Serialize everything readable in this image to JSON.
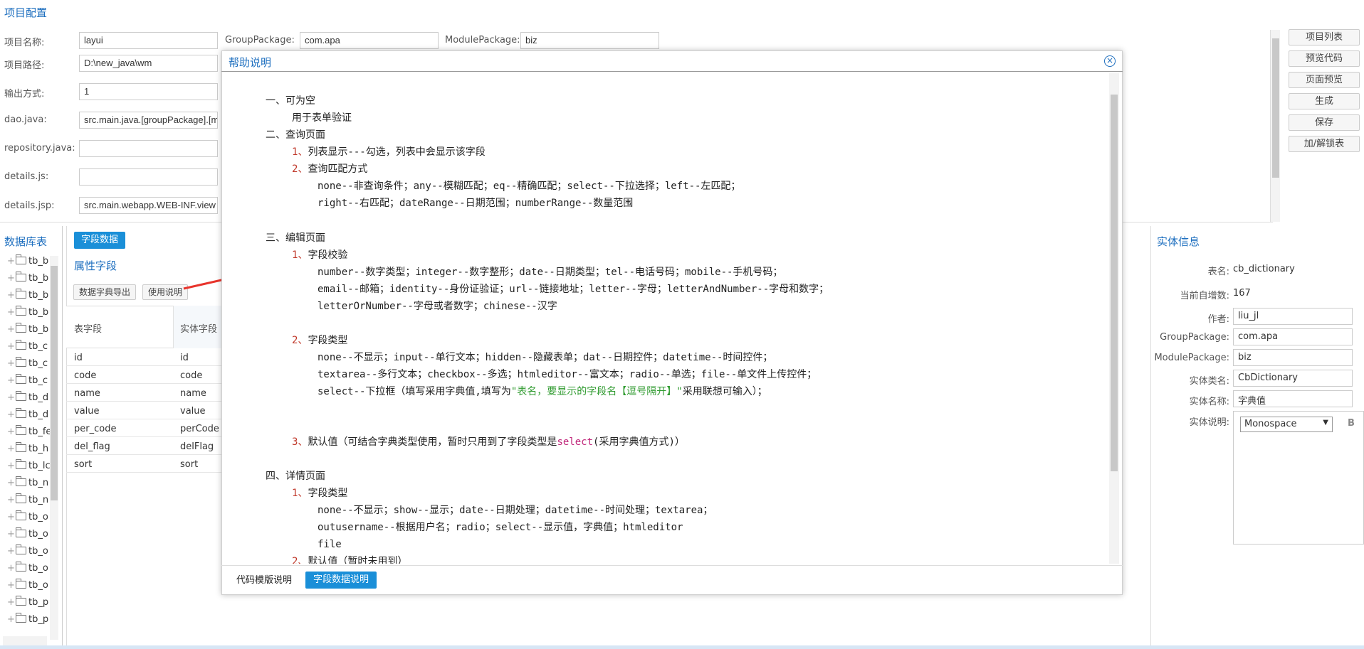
{
  "top": {
    "title": "项目配置",
    "fields": {
      "project_name": {
        "label": "项目名称:",
        "value": "layui"
      },
      "group_package": {
        "label": "GroupPackage:",
        "value": "com.apa"
      },
      "module_package": {
        "label": "ModulePackage:",
        "value": "biz"
      },
      "project_path": {
        "label": "项目路径:",
        "value": "D:\\new_java\\wm"
      },
      "output_mode": {
        "label": "输出方式:",
        "value": "1"
      },
      "dao_java": {
        "label": "dao.java:",
        "value": "src.main.java.[groupPackage].[m"
      },
      "repository_java": {
        "label": "repository.java:",
        "value": ""
      },
      "details_js": {
        "label": "details.js:",
        "value": ""
      },
      "details_jsp": {
        "label": "details.jsp:",
        "value": "src.main.webapp.WEB-INF.view"
      }
    },
    "buttons": [
      "项目列表",
      "预览代码",
      "页面预览",
      "生成",
      "保存",
      "加/解锁表"
    ]
  },
  "left": {
    "title": "数据库表",
    "items": [
      "tb_b",
      "tb_b",
      "tb_b",
      "tb_b",
      "tb_b",
      "tb_c",
      "tb_c",
      "tb_c",
      "tb_d",
      "tb_d",
      "tb_fe",
      "tb_h",
      "tb_lc",
      "tb_n",
      "tb_n",
      "tb_o",
      "tb_o",
      "tb_o",
      "tb_o",
      "tb_o",
      "tb_p",
      "tb_p"
    ]
  },
  "mid": {
    "tab": "字段数据",
    "attr_title": "属性字段",
    "export_btn": "数据字典导出",
    "help_btn": "使用说明",
    "col_table": "表字段",
    "col_entity": "实体字段",
    "rows": [
      [
        "id",
        "id"
      ],
      [
        "code",
        "code"
      ],
      [
        "name",
        "name"
      ],
      [
        "value",
        "value"
      ],
      [
        "per_code",
        "perCode"
      ],
      [
        "del_flag",
        "delFlag"
      ],
      [
        "sort",
        "sort"
      ]
    ]
  },
  "right": {
    "title": "实体信息",
    "table_name": {
      "label": "表名:",
      "value": "cb_dictionary"
    },
    "auto_inc": {
      "label": "当前自增数:",
      "value": "167"
    },
    "author": {
      "label": "作者:",
      "value": "liu_jl"
    },
    "group_package": {
      "label": "GroupPackage:",
      "value": "com.apa"
    },
    "module_package": {
      "label": "ModulePackage:",
      "value": "biz"
    },
    "entity_class": {
      "label": "实体类名:",
      "value": "CbDictionary"
    },
    "entity_name": {
      "label": "实体名称:",
      "value": "字典值"
    },
    "entity_desc": {
      "label": "实体说明:",
      "font": "Monospace",
      "bold": "B"
    }
  },
  "modal": {
    "title": "帮助说明",
    "close": "×",
    "lines": {
      "l1": "一、可为空",
      "l2": "用于表单验证",
      "l3": "二、查询页面",
      "l4a": "1、",
      "l4": "列表显示---勾选，列表中会显示该字段",
      "l5a": "2、",
      "l5": "查询匹配方式",
      "l6": "none--非查询条件；any--模糊匹配；eq--精确匹配；select--下拉选择；left--左匹配；",
      "l7": "right--右匹配；dateRange--日期范围；numberRange--数量范围",
      "l8": "三、编辑页面",
      "l9a": "1、",
      "l9": "字段校验",
      "l10": "number--数字类型；integer--数字整形；date--日期类型；tel--电话号码；mobile--手机号码；",
      "l11": "email--邮箱；identity--身份证验证；url--链接地址；letter--字母；letterAndNumber--字母和数字；",
      "l12": "letterOrNumber--字母或者数字；chinese--汉字",
      "l13a": "2、",
      "l13": "字段类型",
      "l14": "none--不显示；input--单行文本；hidden--隐藏表单；dat--日期控件；datetime--时间控件；",
      "l15": "textarea--多行文本；checkbox--多选；htmleditor--富文本；radio--单选；file--单文件上传控件；",
      "l16a": "select--下拉框（填写采用字典值,填写为",
      "l16b": "\"表名，要显示的字段名【逗号隔开】\"",
      "l16c": "采用联想可输入）；",
      "l17a": "3、",
      "l17b": "默认值（可结合字典类型使用，暂时只用到了字段类型是",
      "l17c": "select",
      "l17d": "(采用字典值方式)）",
      "l18": "四、详情页面",
      "l19a": "1、",
      "l19": "字段类型",
      "l20": "none--不显示；show--显示；date--日期处理；datetime--时间处理；textarea；",
      "l21": "outusername--根据用户名；radio；select--显示值，字典值；htmleditor",
      "l22": "file",
      "l23a": "2、",
      "l23": "默认值（暂时未用到）"
    },
    "footer_tpl": "代码模版说明",
    "footer_field": "字段数据说明"
  }
}
